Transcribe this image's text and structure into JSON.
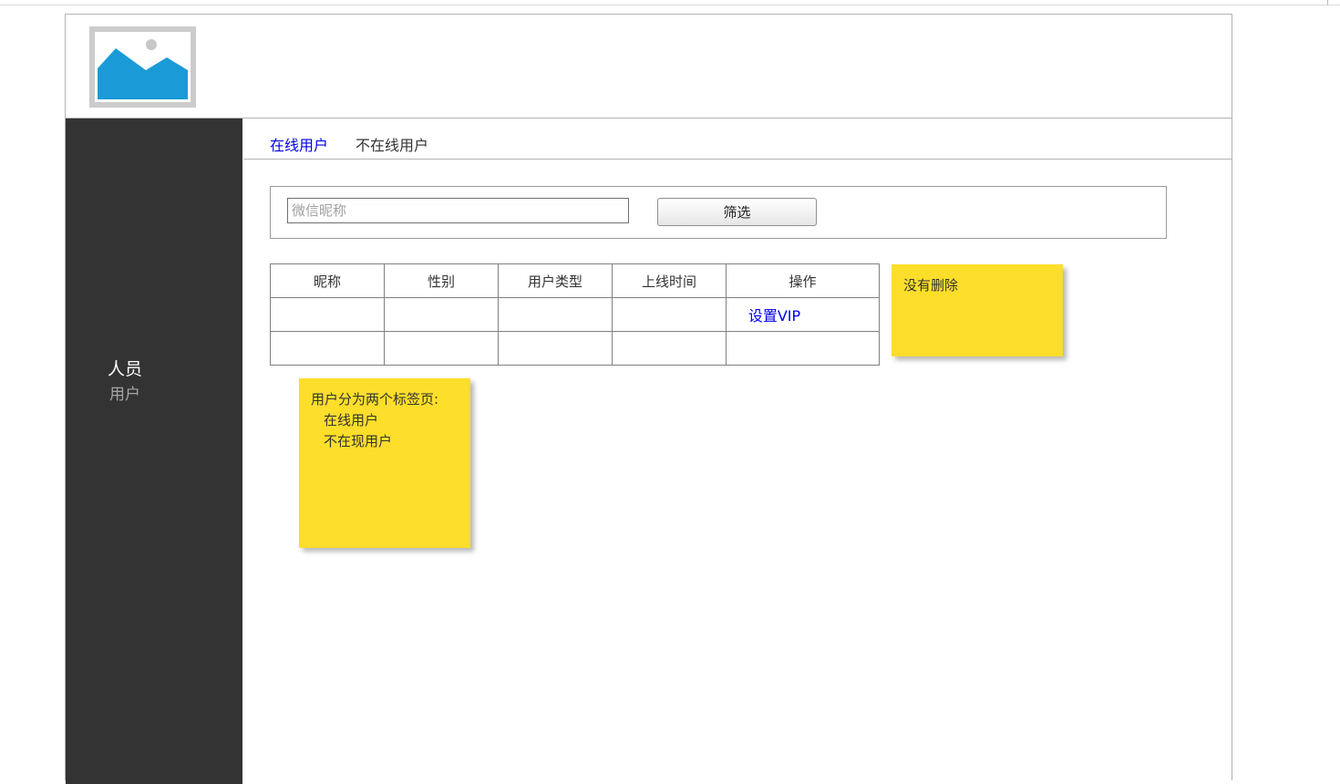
{
  "header": {
    "logo_icon": "image-placeholder-icon"
  },
  "sidebar": {
    "items": [
      {
        "label": "人员"
      },
      {
        "label": "用户"
      }
    ]
  },
  "tabs": [
    {
      "label": "在线用户",
      "active": true
    },
    {
      "label": "不在线用户",
      "active": false
    }
  ],
  "filter": {
    "placeholder": "微信昵称",
    "value": "",
    "button_label": "筛选"
  },
  "table": {
    "columns": [
      "昵称",
      "性别",
      "用户类型",
      "上线时间",
      "操作"
    ],
    "rows": [
      [
        "",
        "",
        "",
        "",
        "设置VIP"
      ],
      [
        "",
        "",
        "",
        "",
        ""
      ]
    ]
  },
  "notes": {
    "note1": "没有删除",
    "note2": {
      "lines": [
        "用户分为两个标签页:",
        "在线用户",
        "不在现用户"
      ]
    }
  },
  "colors": {
    "sidebar_bg": "#333333",
    "link_blue": "#0000ee",
    "sticky_yellow": "#fdde2a",
    "logo_blue": "#1a9bd7"
  }
}
